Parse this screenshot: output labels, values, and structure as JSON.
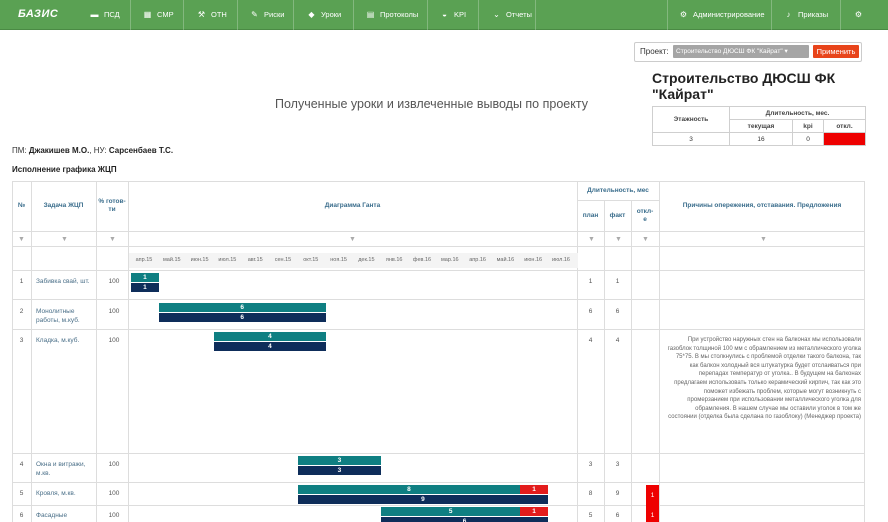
{
  "nav": {
    "logo": "БАЗИС",
    "items": [
      {
        "label": "ПСД",
        "icon": "folder-icon"
      },
      {
        "label": "СМР",
        "icon": "building-icon"
      },
      {
        "label": "ОТН",
        "icon": "wrench-icon"
      },
      {
        "label": "Риски",
        "icon": "pin-icon"
      },
      {
        "label": "Уроки",
        "icon": "graduation-cap-icon"
      },
      {
        "label": "Протоколы",
        "icon": "document-icon"
      },
      {
        "label": "KPI",
        "icon": "dashboard-icon"
      },
      {
        "label": "Отчеты",
        "icon": "chevron-down-icon"
      }
    ],
    "admin_label": "Администрирование",
    "orders_label": "Приказы"
  },
  "project_selector": {
    "label": "Проект:",
    "selected": "Строительство ДЮСШ ФК \"Кайрат\"",
    "apply_label": "Применить"
  },
  "main_title": "Полученные уроки и извлеченные выводы по проекту",
  "project_title": "Строительство ДЮСШ ФК \"Кайрат\"",
  "kpi_table": {
    "floors_header": "Этажность",
    "duration_header": "Длительность, мес.",
    "current_header": "текущая",
    "kpi_header": "kpi",
    "dev_header": "откл.",
    "floors": "3",
    "current": "16",
    "kpi": "0",
    "dev": "",
    "dev_color": "#ee0000"
  },
  "pm_line": {
    "pm_label": "ПМ:",
    "pm_name": "Джакишев М.О.",
    "nu_label": ", НУ:",
    "nu_name": "Сарсенбаев Т.С."
  },
  "section_title": "Исполнение графика ЖЦП",
  "table": {
    "headers": {
      "num": "№",
      "task": "Задача ЖЦП",
      "ready": "% готов-ти",
      "gantt": "Диаграмма Ганта",
      "duration": "Длительность, мес",
      "plan": "план",
      "fact": "факт",
      "dev": "откл-е",
      "reasons": "Причины опережения, отставания. Предложения"
    },
    "months": [
      "апр.15",
      "май.15",
      "июн.15",
      "июл.15",
      "авг.15",
      "сен.15",
      "окт.15",
      "ноя.15",
      "дек.15",
      "янв.16",
      "фев.16",
      "мар.16",
      "апр.16",
      "май.16",
      "июн.16",
      "июл.16"
    ],
    "rows": [
      {
        "num": "1",
        "task": "Забивка свай, шт.",
        "ready": "100",
        "plan_start": 0,
        "plan": 1,
        "fact_start": 0,
        "fact": 1,
        "plan_label": "1",
        "fact_label": "1",
        "plan_col": "1",
        "fact_col": "1",
        "dev": "",
        "reason": ""
      },
      {
        "num": "2",
        "task": "Монолитные работы, м.куб.",
        "ready": "100",
        "plan_start": 1,
        "plan": 6,
        "fact_start": 1,
        "fact": 6,
        "plan_label": "6",
        "fact_label": "6",
        "plan_col": "6",
        "fact_col": "6",
        "dev": "",
        "reason": ""
      },
      {
        "num": "3",
        "task": "Кладка, м.куб.",
        "ready": "100",
        "plan_start": 3,
        "plan": 4,
        "fact_start": 3,
        "fact": 4,
        "plan_label": "4",
        "fact_label": "4",
        "plan_col": "4",
        "fact_col": "4",
        "dev": "",
        "reason": "При устройство наружных стен на балконах мы использовали газоблок толщиной 100 мм с обрамлением из металлического уголка 75*75. В мы столкнулись с проблемой отделки такого балкона, так как балкон холодный вся штукатурка будет отслаиваться при перепадах температур от уголка.. В будущем на балконах предлагаем использовать только керамический кирпич, так как это поможет избежать проблем, которые могут возникнуть с промерзанием при использовании металлического уголка для обрамления. В нашем случае мы оставили уголок в том же состоянии (отделка была сделана по газоблоку) (Менеджер проекта)"
      },
      {
        "num": "4",
        "task": "Окна и витражи, м.кв.",
        "ready": "100",
        "plan_start": 6,
        "plan": 3,
        "fact_start": 6,
        "fact": 3,
        "plan_label": "3",
        "fact_label": "3",
        "plan_col": "3",
        "fact_col": "3",
        "dev": "",
        "reason": ""
      },
      {
        "num": "5",
        "task": "Кровля, м.кв.",
        "ready": "100",
        "plan_start": 6,
        "plan": 8,
        "fact_start": 6,
        "fact": 9,
        "plan_label": "8",
        "fact_label": "9",
        "over_label": "1",
        "plan_col": "8",
        "fact_col": "9",
        "dev": "1",
        "reason": ""
      },
      {
        "num": "6",
        "task": "Фасадные",
        "ready": "100",
        "plan_start": 9,
        "plan": 5,
        "fact_start": 9,
        "fact": 6,
        "plan_label": "5",
        "fact_label": "6",
        "over_label": "1",
        "plan_col": "5",
        "fact_col": "6",
        "dev": "1",
        "reason": ""
      }
    ]
  }
}
